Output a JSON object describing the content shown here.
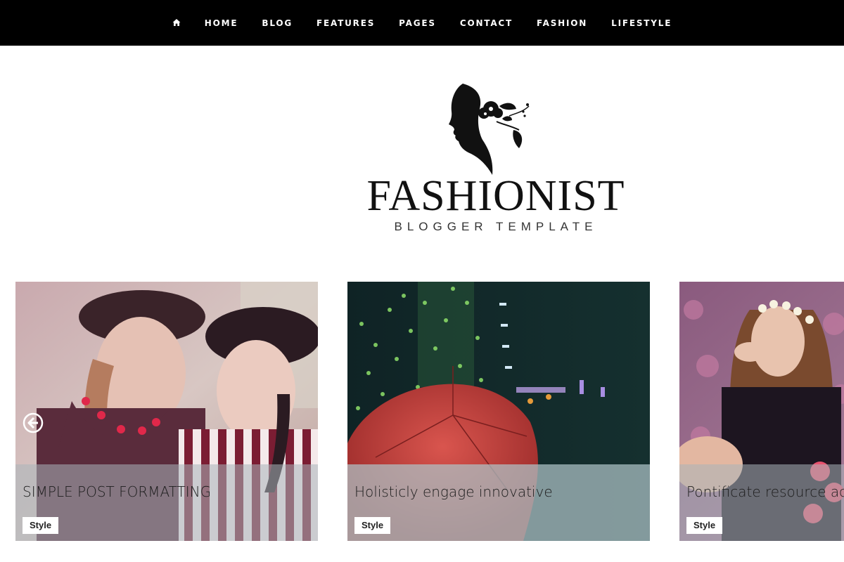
{
  "nav": {
    "home_icon": "home-icon",
    "items": [
      {
        "label": "HOME"
      },
      {
        "label": "BLOG"
      },
      {
        "label": "FEATURES"
      },
      {
        "label": "PAGES"
      },
      {
        "label": "CONTACT"
      },
      {
        "label": "FASHION"
      },
      {
        "label": "LIFESTYLE"
      }
    ]
  },
  "logo": {
    "title": "FASHIONIST",
    "subtitle": "BLOGGER TEMPLATE",
    "icon": "woman-silhouette-with-flower"
  },
  "slider": {
    "prev_icon": "arrow-left-circle-icon",
    "cards": [
      {
        "title": "SIMPLE POST FORMATTING",
        "tag": "Style",
        "image": "two girls in berets"
      },
      {
        "title": "Holisticly engage innovative",
        "tag": "Style",
        "image": "red umbrella with city bokeh"
      },
      {
        "title": "Pontificate resource ac",
        "tag": "Style",
        "image": "woman with flower crown"
      }
    ]
  },
  "colors": {
    "nav_bg": "#000000",
    "nav_text": "#ffffff",
    "overlay": "#aab4b9",
    "tag_bg": "#ffffff"
  }
}
